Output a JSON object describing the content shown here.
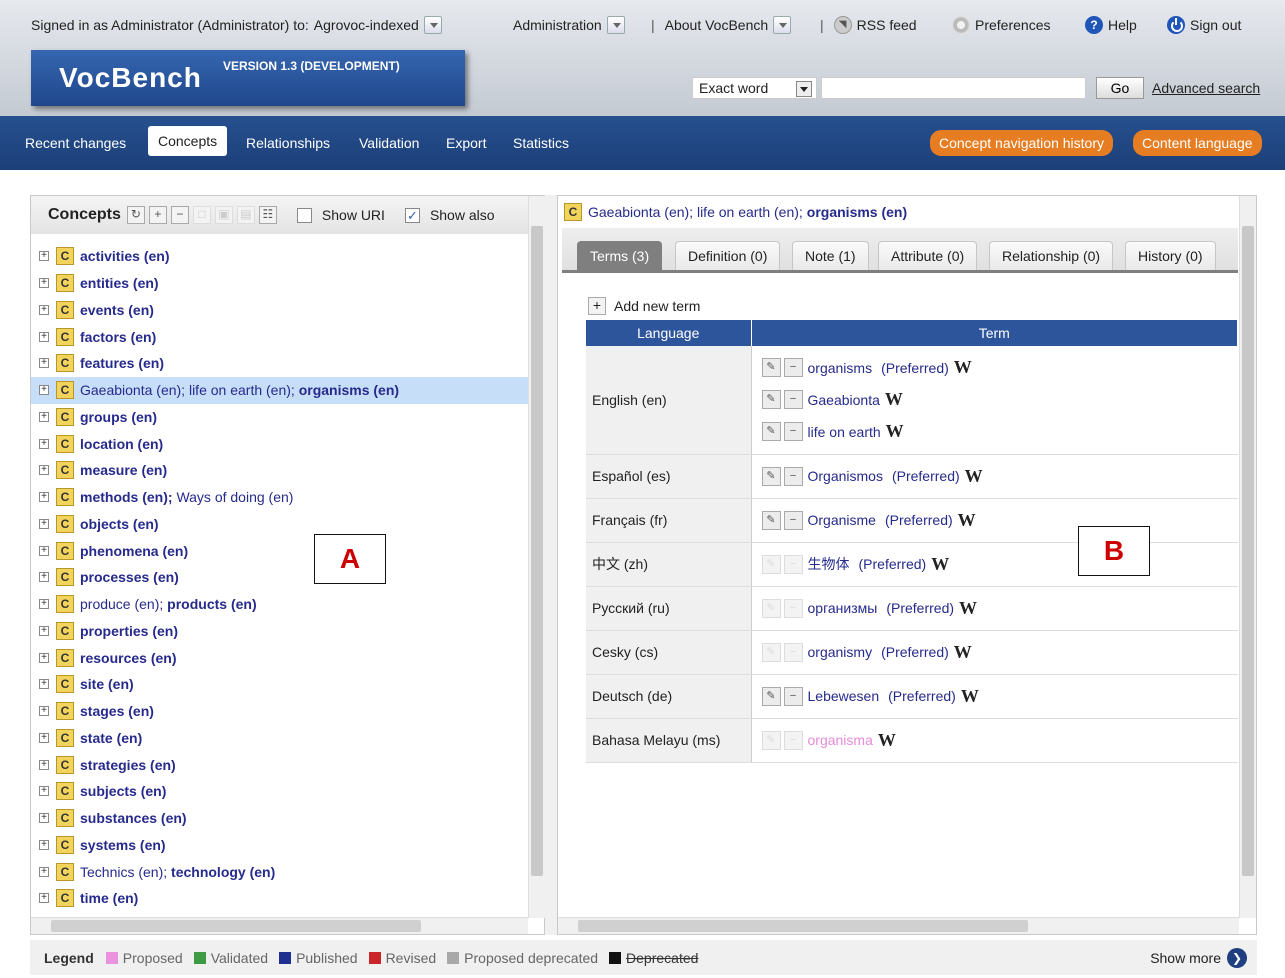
{
  "topbar": {
    "signed_in": "Signed in as Administrator (Administrator) to:",
    "project": "Agrovoc-indexed",
    "administration": "Administration",
    "about": "About VocBench",
    "rss": "RSS feed",
    "preferences": "Preferences",
    "help": "Help",
    "sign_out": "Sign out",
    "separator": "|"
  },
  "logo": {
    "name": "VocBench",
    "version": "VERSION 1.3 (DEVELOPMENT)"
  },
  "search": {
    "mode": "Exact word",
    "query": "",
    "go": "Go",
    "advanced": "Advanced search"
  },
  "nav": {
    "items": [
      "Recent changes",
      "Concepts",
      "Relationships",
      "Validation",
      "Export",
      "Statistics"
    ],
    "active": "Concepts",
    "history_button": "Concept navigation history",
    "language_button": "Content language"
  },
  "concepts_panel": {
    "title": "Concepts",
    "show_uri": "Show URI",
    "show_also": "Show also",
    "show_uri_checked": false,
    "show_also_checked": true,
    "badge": "C",
    "tree": [
      {
        "parts": [
          {
            "t": "activities (en)",
            "b": true
          }
        ]
      },
      {
        "parts": [
          {
            "t": "entities (en)",
            "b": true
          }
        ]
      },
      {
        "parts": [
          {
            "t": "events (en)",
            "b": true
          }
        ]
      },
      {
        "parts": [
          {
            "t": "factors (en)",
            "b": true
          }
        ]
      },
      {
        "parts": [
          {
            "t": "features (en)",
            "b": true
          }
        ]
      },
      {
        "parts": [
          {
            "t": "Gaeabionta (en); life on earth (en); ",
            "b": false
          },
          {
            "t": "organisms (en)",
            "b": true
          }
        ],
        "selected": true
      },
      {
        "parts": [
          {
            "t": "groups (en)",
            "b": true
          }
        ]
      },
      {
        "parts": [
          {
            "t": "location (en)",
            "b": true
          }
        ]
      },
      {
        "parts": [
          {
            "t": "measure (en)",
            "b": true
          }
        ]
      },
      {
        "parts": [
          {
            "t": "methods (en);",
            "b": true
          },
          {
            "t": " Ways of doing (en)",
            "b": false
          }
        ]
      },
      {
        "parts": [
          {
            "t": "objects (en)",
            "b": true
          }
        ]
      },
      {
        "parts": [
          {
            "t": "phenomena (en)",
            "b": true
          }
        ]
      },
      {
        "parts": [
          {
            "t": "processes (en)",
            "b": true
          }
        ]
      },
      {
        "parts": [
          {
            "t": "produce (en); ",
            "b": false
          },
          {
            "t": "products (en)",
            "b": true
          }
        ]
      },
      {
        "parts": [
          {
            "t": "properties (en)",
            "b": true
          }
        ]
      },
      {
        "parts": [
          {
            "t": "resources (en)",
            "b": true
          }
        ]
      },
      {
        "parts": [
          {
            "t": "site (en)",
            "b": true
          }
        ]
      },
      {
        "parts": [
          {
            "t": "stages (en)",
            "b": true
          }
        ]
      },
      {
        "parts": [
          {
            "t": "state (en)",
            "b": true
          }
        ]
      },
      {
        "parts": [
          {
            "t": "strategies (en)",
            "b": true
          }
        ]
      },
      {
        "parts": [
          {
            "t": "subjects (en)",
            "b": true
          }
        ]
      },
      {
        "parts": [
          {
            "t": "substances (en)",
            "b": true
          }
        ]
      },
      {
        "parts": [
          {
            "t": "systems (en)",
            "b": true
          }
        ]
      },
      {
        "parts": [
          {
            "t": "Technics (en); ",
            "b": false
          },
          {
            "t": "technology (en)",
            "b": true
          }
        ]
      },
      {
        "parts": [
          {
            "t": "time (en)",
            "b": true
          }
        ]
      }
    ]
  },
  "detail_panel": {
    "header_normal": "Gaeabionta (en); life on earth (en); ",
    "header_bold": "organisms (en)",
    "badge": "C",
    "tabs": [
      "Terms (3)",
      "Definition (0)",
      "Note (1)",
      "Attribute (0)",
      "Relationship (0)",
      "History (0)"
    ],
    "active_tab": "Terms (3)",
    "add_term": "Add new term",
    "col_language": "Language",
    "col_term": "Term",
    "preferred_label": "(Preferred)",
    "wiki_symbol": "W",
    "rows": [
      {
        "lang": "English (en)",
        "terms": [
          {
            "text": "organisms",
            "preferred": true,
            "editable": true
          },
          {
            "text": "Gaeabionta",
            "preferred": false,
            "editable": true
          },
          {
            "text": "life on earth",
            "preferred": false,
            "editable": true
          }
        ]
      },
      {
        "lang": "Español (es)",
        "terms": [
          {
            "text": "Organismos",
            "preferred": true,
            "editable": true
          }
        ]
      },
      {
        "lang": "Français (fr)",
        "terms": [
          {
            "text": "Organisme",
            "preferred": true,
            "editable": true
          }
        ]
      },
      {
        "lang": "中文 (zh)",
        "terms": [
          {
            "text": "生物体",
            "preferred": true,
            "editable": false
          }
        ]
      },
      {
        "lang": "Русский (ru)",
        "terms": [
          {
            "text": "организмы",
            "preferred": true,
            "editable": false
          }
        ]
      },
      {
        "lang": "Cesky (cs)",
        "terms": [
          {
            "text": "organismy",
            "preferred": true,
            "editable": false
          }
        ]
      },
      {
        "lang": "Deutsch (de)",
        "terms": [
          {
            "text": "Lebewesen",
            "preferred": true,
            "editable": true
          }
        ]
      },
      {
        "lang": "Bahasa Melayu (ms)",
        "terms": [
          {
            "text": "organisma",
            "preferred": false,
            "editable": false,
            "status": "proposed"
          }
        ]
      }
    ]
  },
  "markers": {
    "a": "A",
    "b": "B"
  },
  "legend": {
    "title": "Legend",
    "items": [
      {
        "label": "Proposed",
        "color": "#ea92e0"
      },
      {
        "label": "Validated",
        "color": "#3f9a44"
      },
      {
        "label": "Published",
        "color": "#1e2f8f"
      },
      {
        "label": "Revised",
        "color": "#c9252b"
      },
      {
        "label": "Proposed deprecated",
        "color": "#a8a8a8"
      },
      {
        "label": "Deprecated",
        "color": "#111111",
        "strike": true
      }
    ],
    "show_more": "Show more"
  }
}
